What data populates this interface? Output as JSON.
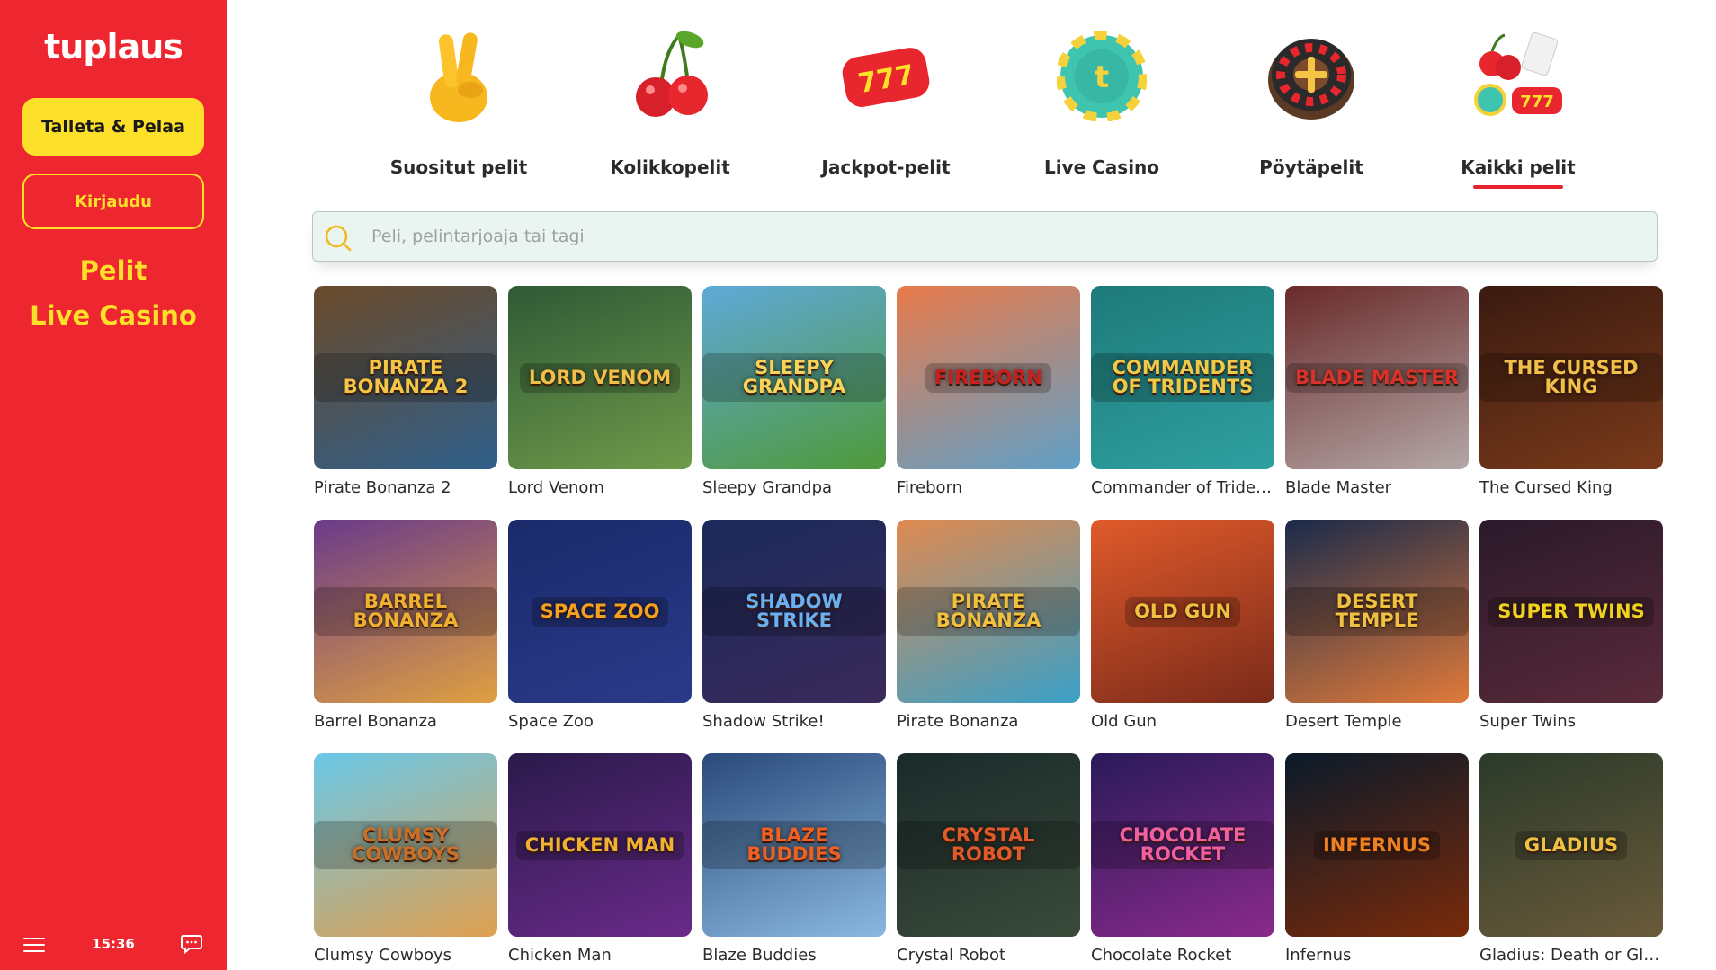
{
  "sidebar": {
    "logo": "tuplaus",
    "deposit_label": "Talleta & Pelaa",
    "login_label": "Kirjaudu",
    "nav": [
      {
        "label": "Pelit"
      },
      {
        "label": "Live Casino"
      }
    ],
    "clock": "15:36",
    "menu_icon": "hamburger-icon",
    "chat_icon": "chat-icon"
  },
  "categories": [
    {
      "label": "Suositut pelit",
      "icon": "victory-hand-icon",
      "active": false
    },
    {
      "label": "Kolikkopelit",
      "icon": "cherries-icon",
      "active": false
    },
    {
      "label": "Jackpot-pelit",
      "icon": "triple-seven-icon",
      "active": false
    },
    {
      "label": "Live Casino",
      "icon": "casino-chip-icon",
      "active": false
    },
    {
      "label": "Pöytäpelit",
      "icon": "roulette-wheel-icon",
      "active": false
    },
    {
      "label": "Kaikki pelit",
      "icon": "all-games-icon",
      "active": true
    }
  ],
  "search": {
    "placeholder": "Peli, pelintarjoaja tai tagi",
    "value": ""
  },
  "games": [
    {
      "name": "Pirate Bonanza 2",
      "art": "PIRATE BONANZA 2",
      "bg": [
        "#6b4a2a",
        "#2f5f8a"
      ],
      "fg": "#f6c545"
    },
    {
      "name": "Lord Venom",
      "art": "LORD VENOM",
      "bg": [
        "#2e5a36",
        "#6f9a4a"
      ],
      "fg": "#f2c04a"
    },
    {
      "name": "Sleepy Grandpa",
      "art": "SLEEPY GRANDPA",
      "bg": [
        "#5fa8d8",
        "#4f9a3a"
      ],
      "fg": "#f7d35a"
    },
    {
      "name": "Fireborn",
      "art": "FIREBORN",
      "bg": [
        "#e87a4a",
        "#5fa0c8"
      ],
      "fg": "#c8201e"
    },
    {
      "name": "Commander of Tridents",
      "art": "COMMANDER OF TRIDENTS",
      "bg": [
        "#1e7a7a",
        "#2fa0a0"
      ],
      "fg": "#f0c84a"
    },
    {
      "name": "Blade Master",
      "art": "BLADE MASTER",
      "bg": [
        "#6a2a2a",
        "#b4a7a7"
      ],
      "fg": "#d8322a"
    },
    {
      "name": "The Cursed King",
      "art": "THE CURSED KING",
      "bg": [
        "#3a1a10",
        "#7a3a1a"
      ],
      "fg": "#f0c04a"
    },
    {
      "name": "Barrel Bonanza",
      "art": "BARREL BONANZA",
      "bg": [
        "#6a3a8a",
        "#e0a040"
      ],
      "fg": "#f0b030"
    },
    {
      "name": "Space Zoo",
      "art": "SPACE ZOO",
      "bg": [
        "#1a2a6a",
        "#2a3a8a"
      ],
      "fg": "#f4a020"
    },
    {
      "name": "Shadow Strike!",
      "art": "SHADOW STRIKE",
      "bg": [
        "#1a2a5a",
        "#3a2a5a"
      ],
      "fg": "#6ab0f0"
    },
    {
      "name": "Pirate Bonanza",
      "art": "PIRATE BONANZA",
      "bg": [
        "#e08a50",
        "#3aa0c8"
      ],
      "fg": "#f0c040"
    },
    {
      "name": "Old Gun",
      "art": "OLD GUN",
      "bg": [
        "#e05a2a",
        "#7a2a1a"
      ],
      "fg": "#f0c040"
    },
    {
      "name": "Desert Temple",
      "art": "DESERT TEMPLE",
      "bg": [
        "#1a2a4a",
        "#e07a3a"
      ],
      "fg": "#f0c040"
    },
    {
      "name": "Super Twins",
      "art": "SUPER TWINS",
      "bg": [
        "#2a1a2a",
        "#5a2a3a"
      ],
      "fg": "#f0d020"
    },
    {
      "name": "Clumsy Cowboys",
      "art": "CLUMSY COWBOYS",
      "bg": [
        "#6ac8e8",
        "#e0a050"
      ],
      "fg": "#c8702a"
    },
    {
      "name": "Chicken Man",
      "art": "CHICKEN MAN",
      "bg": [
        "#2a1a4a",
        "#6a2a8a"
      ],
      "fg": "#f0b030"
    },
    {
      "name": "Blaze Buddies",
      "art": "BLAZE BUDDIES",
      "bg": [
        "#2a4a7a",
        "#8ab8e0"
      ],
      "fg": "#f06020"
    },
    {
      "name": "Crystal Robot",
      "art": "CRYSTAL ROBOT",
      "bg": [
        "#1a2a2a",
        "#3a4a3a"
      ],
      "fg": "#e05a2a"
    },
    {
      "name": "Chocolate Rocket",
      "art": "CHOCOLATE ROCKET",
      "bg": [
        "#2a1a5a",
        "#8a2a8a"
      ],
      "fg": "#f060a0"
    },
    {
      "name": "Infernus",
      "art": "INFERNUS",
      "bg": [
        "#0a1a2a",
        "#7a2a0a"
      ],
      "fg": "#f08020"
    },
    {
      "name": "Gladius: Death or Glory",
      "art": "GLADIUS",
      "bg": [
        "#2a3a2a",
        "#6a5a3a"
      ],
      "fg": "#f0c040"
    }
  ],
  "colors": {
    "brand_red": "#ee2630",
    "brand_yellow": "#fde02a",
    "active_underline": "#e8222c",
    "search_bg": "#eaf4f1"
  }
}
